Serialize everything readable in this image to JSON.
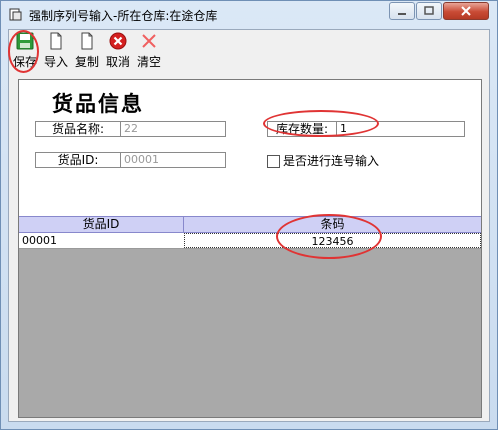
{
  "window": {
    "title": "强制序列号输入-所在仓库:在途仓库"
  },
  "toolbar": {
    "save_label": "保存",
    "import_label": "导入",
    "copy_label": "复制",
    "cancel_label": "取消",
    "clear_label": "清空"
  },
  "form": {
    "heading": "货品信息",
    "item_name_label": "货品名称:",
    "item_name_value": "22",
    "stock_qty_label": "库存数量:",
    "stock_qty_value": "1",
    "item_id_label": "货品ID:",
    "item_id_value": "00001",
    "serial_checkbox_label": "是否进行连号输入",
    "serial_checkbox_checked": false
  },
  "grid": {
    "columns": [
      "货品ID",
      "条码"
    ],
    "rows": [
      {
        "item_id": "00001",
        "barcode": "123456"
      }
    ]
  },
  "colors": {
    "annotation": "#e03434",
    "grid_header": "#cfd0f5",
    "grid_background": "#a9a9a9"
  }
}
